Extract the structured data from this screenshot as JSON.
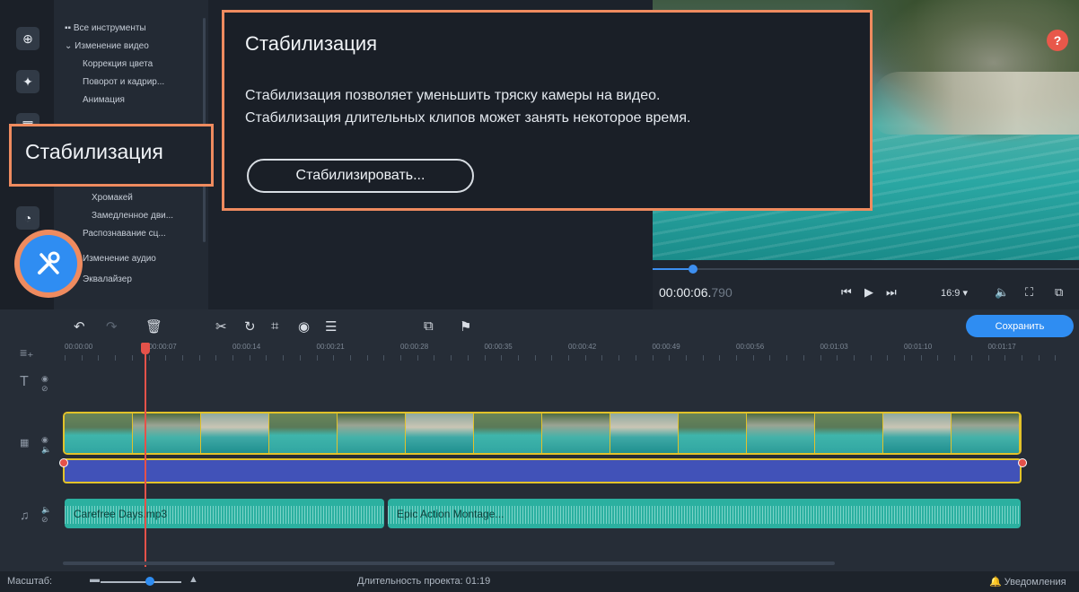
{
  "callout": {
    "title": "Стабилизация",
    "line1": "Стабилизация позволяет уменьшить тряску камеры на видео.",
    "line2": "Стабилизация длительных клипов может занять некоторое время.",
    "button": "Стабилизировать..."
  },
  "highlight_label": "Стабилизация",
  "tools": {
    "all": "Все инструменты",
    "video_edit": "Изменение видео",
    "items_top": [
      "Коррекция цвета",
      "Поворот и кадрир...",
      "Анимация"
    ],
    "items_bottom": [
      "Хромакей",
      "Замедленное дви...",
      "Распознавание сц...",
      "Изменение аудио",
      "Эквалайзер"
    ]
  },
  "player": {
    "time": "00:00:06.",
    "time_frac": "790",
    "aspect": "16:9 ▾",
    "progress": 0.085
  },
  "help": "?",
  "save": "Сохранить",
  "ruler": [
    "00:00:00",
    "00:00:07",
    "00:00:14",
    "00:00:21",
    "00:00:28",
    "00:00:35",
    "00:00:42",
    "00:00:49",
    "00:00:56",
    "00:01:03",
    "00:01:10",
    "00:01:17"
  ],
  "audio_clips": [
    "Carefree Days.mp3",
    "Epic Action Montage..."
  ],
  "status": {
    "zoom": "Масштаб:",
    "duration": "Длительность проекта: 01:19",
    "notifications": "Уведомления"
  },
  "colors": {
    "accent": "#2f8df2",
    "highlight": "#ef8b5f",
    "playhead": "#e4524a",
    "clip_border": "#e2c22a",
    "audio": "#2bb0a0"
  }
}
